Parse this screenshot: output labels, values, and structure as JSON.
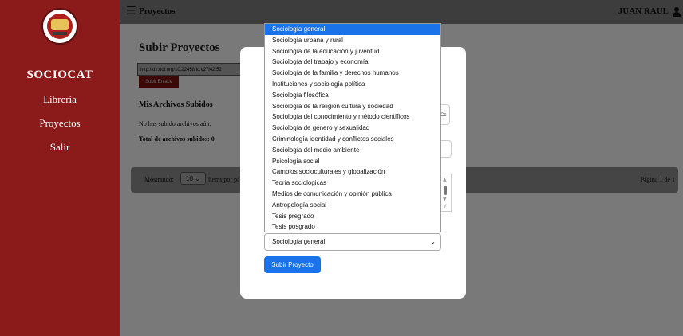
{
  "sidebar": {
    "brand": "SOCIOCAT",
    "items": [
      {
        "label": "Librería"
      },
      {
        "label": "Proyectos"
      },
      {
        "label": "Salir"
      }
    ]
  },
  "topbar": {
    "menu_icon": "hamburger-menu-icon",
    "title": "Proyectos",
    "user_name": "JUAN RAUL",
    "user_icon": "user-icon"
  },
  "main": {
    "title": "Subir Proyectos",
    "url_input_value": "http://dx.doi.org/10.22458/ic.v27i42.52",
    "link_button": "Subir Enlace",
    "files_heading": "Mis Archivos Subidos",
    "no_files": "No has subido archivos aún.",
    "total_files": "Total de archivos subidos: 0",
    "pager": {
      "showing": "Mostrando:",
      "per_page": "10",
      "items_per_page": "ítems por pá",
      "page_info": "Página 1 de 1"
    }
  },
  "modal": {
    "partial_field_text": "Cc",
    "selected_category": "Sociología general",
    "submit_label": "Subir Proyecto",
    "dropdown_options": [
      "Sociología general",
      "Sociología urbana y rural",
      "Sociología de la educación y juventud",
      "Sociología del trabajo y economía",
      "Sociología de la familia y derechos humanos",
      "Instituciones y sociología política",
      "Sociología filosófica",
      "Sociología de la religión cultura y sociedad",
      "Sociología del conocimiento y método científicos",
      "Sociología de género y sexualidad",
      "Criminología identidad y conflictos sociales",
      "Sociología del medio ambiente",
      "Psicología social",
      "Cambios socioculturales y globalización",
      "Teoría sociológicas",
      "Medios de comunicación y opinión pública",
      "Antropología social",
      "Tesis pregrado",
      "Tesis posgrado"
    ]
  },
  "colors": {
    "sidebar": "#8b1a1a",
    "accent": "#1a73e8",
    "overlay": "rgba(0,0,0,0.5)"
  }
}
